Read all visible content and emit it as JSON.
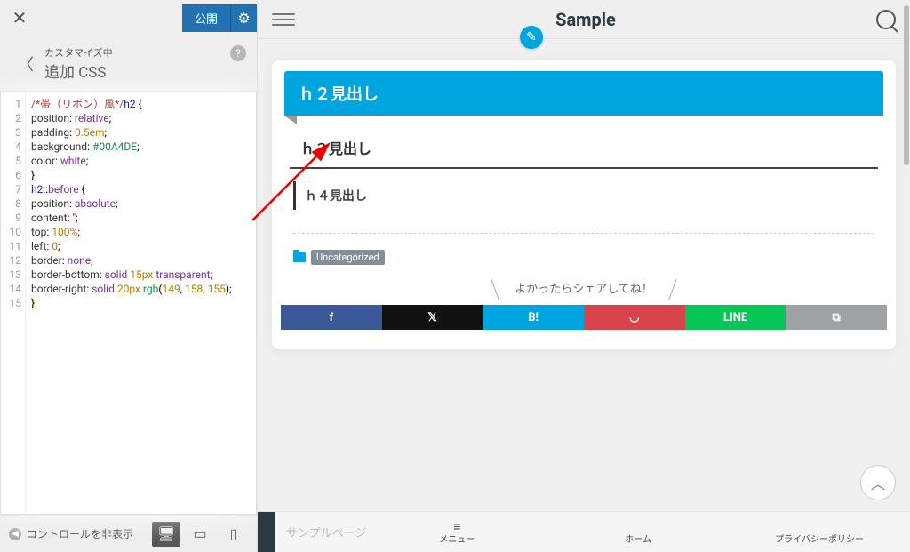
{
  "customizer": {
    "publish_label": "公開",
    "subtitle": "カスタマイズ中",
    "title": "追加 CSS",
    "footer_toggle": "コントロールを非表示"
  },
  "code": [
    {
      "ln": "1",
      "cls": "",
      "html": "<span class='c-comment'>/*帯（リボン）風*/</span><span class='c-tag'>h2</span> {"
    },
    {
      "ln": "2",
      "cls": "pl2",
      "html": "<span class='c-prop'>position</span>: <span class='c-kw'>relative</span>;"
    },
    {
      "ln": "3",
      "cls": "pl2",
      "html": "<span class='c-prop'>padding</span>: <span class='c-num'>0.5em</span>;"
    },
    {
      "ln": "4",
      "cls": "pl2",
      "html": "<span class='c-prop'>background</span>: <span class='c-val'>#00A4DE</span>;"
    },
    {
      "ln": "5",
      "cls": "pl2",
      "html": "<span class='c-prop'>color</span>: <span class='c-kw'>white</span>;"
    },
    {
      "ln": "6",
      "cls": "",
      "html": "}"
    },
    {
      "ln": "7",
      "cls": "",
      "html": "<span class='c-tag'>h2</span>::<span class='c-kw'>before</span> {"
    },
    {
      "ln": "8",
      "cls": "pl2",
      "html": "<span class='c-prop'>position</span>: <span class='c-kw'>absolute</span>;"
    },
    {
      "ln": "9",
      "cls": "pl2",
      "html": "<span class='c-prop'>content</span>: <span class='c-str'>''</span>;"
    },
    {
      "ln": "10",
      "cls": "pl2",
      "html": "<span class='c-prop'>top</span>: <span class='c-num'>100%</span>;"
    },
    {
      "ln": "11",
      "cls": "pl2",
      "html": "<span class='c-prop'>left</span>: <span class='c-num'>0</span>;"
    },
    {
      "ln": "12",
      "cls": "pl2",
      "html": "<span class='c-prop'>border</span>: <span class='c-kw'>none</span>;"
    },
    {
      "ln": "13",
      "cls": "pl2",
      "html": "<span class='c-prop'>border-bottom</span>: <span class='c-kw'>solid</span> <span class='c-num'>15px</span> <span class='c-kw'>transparent</span>;"
    },
    {
      "ln": "14",
      "cls": "pl2",
      "html": "<span class='c-prop'>border-right</span>: <span class='c-kw'>solid</span> <span class='c-num'>20px</span> <span class='c-val'>rgb</span>(<span class='c-num'>149</span>, <span class='c-num'>158</span>, <span class='c-num'>155</span>);"
    },
    {
      "ln": "15",
      "cls": "",
      "html": "<span style='background:#fffbcc;'>}</span>"
    }
  ],
  "preview": {
    "site_title": "Sample",
    "h2": "ｈ２見出し",
    "h3": "ｈ３見出し",
    "h4": "ｈ４見出し",
    "category": "Uncategorized",
    "share_label": "よかったらシェアしてね！",
    "nav_hidden": "サンプルページ",
    "nav_items": [
      "メニュー",
      "ホーム",
      "プライバシーポリシー"
    ]
  },
  "share_buttons": [
    {
      "name": "facebook",
      "glyph": "f",
      "cls": "fb"
    },
    {
      "name": "x-twitter",
      "glyph": "𝕏",
      "cls": "tw"
    },
    {
      "name": "hatena",
      "glyph": "B!",
      "cls": "hb"
    },
    {
      "name": "pocket",
      "glyph": "◡",
      "cls": "pk"
    },
    {
      "name": "line",
      "glyph": "LINE",
      "cls": "ln"
    },
    {
      "name": "copy",
      "glyph": "⧉",
      "cls": "cp"
    }
  ]
}
